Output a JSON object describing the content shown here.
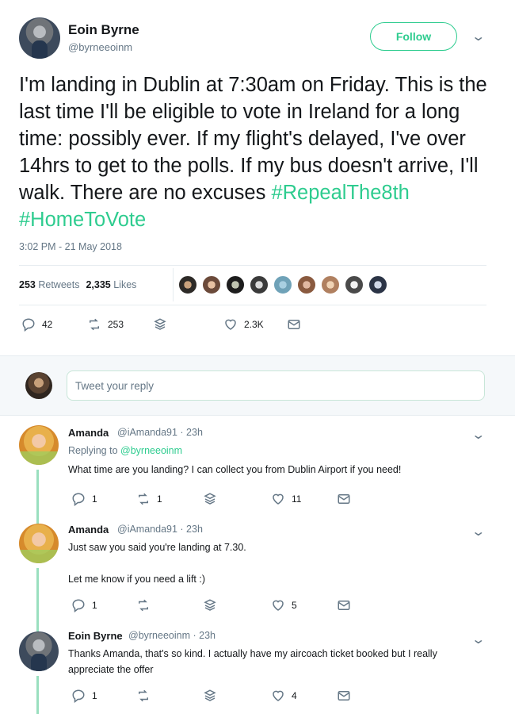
{
  "tweet": {
    "author_name": "Eoin Byrne",
    "author_handle": "@byrneeoinm",
    "follow_label": "Follow",
    "text_main": "I'm landing in Dublin at 7:30am on Friday. This is the last time I'll be eligible to vote in Ireland for a long time: possibly ever. If my flight's delayed, I've over 14hrs to get to the polls. If my bus doesn't arrive, I'll walk. There are no excuses ",
    "hashtag1": "#RepealThe8th",
    "hashtag2": "#HomeToVote",
    "timestamp": "3:02 PM - 21 May 2018",
    "retweets_count": "253",
    "retweets_label": "Retweets",
    "likes_count": "2,335",
    "likes_label": "Likes",
    "actions": {
      "replies": "42",
      "retweets": "253",
      "likes": "2.3K"
    }
  },
  "composer": {
    "placeholder": "Tweet your reply"
  },
  "replies": [
    {
      "name": "Amanda",
      "handle_time": "@iAmanda91 · 23h",
      "replying_prefix": "Replying to",
      "replying_to": "@byrneeoinm",
      "text": "What time are you landing? I can collect you from Dublin Airport if you need!",
      "counts": {
        "replies": "1",
        "retweets": "1",
        "likes": "11"
      }
    },
    {
      "name": "Amanda",
      "handle_time": "@iAmanda91 · 23h",
      "text_line1": "Just saw you said you're landing at 7.30.",
      "text_line2": "Let me know if you need a lift :)",
      "counts": {
        "replies": "1",
        "retweets": "",
        "likes": "5"
      }
    },
    {
      "name": "Eoin Byrne",
      "handle_time": "@byrneeoinm · 23h",
      "text": "Thanks Amanda, that's so kind. I actually have my aircoach ticket booked but I really appreciate the offer",
      "counts": {
        "replies": "1",
        "retweets": "",
        "likes": "4"
      }
    }
  ],
  "colors": {
    "accent": "#2ecc8f",
    "muted": "#657786",
    "thread": "#9adfbf"
  }
}
